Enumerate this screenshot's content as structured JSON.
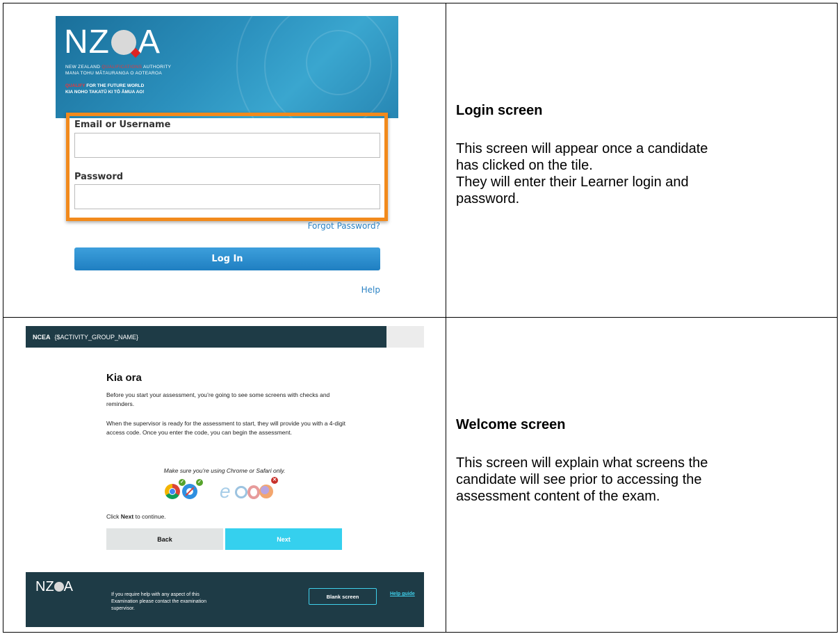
{
  "login_screenshot": {
    "logo_text_left": "NZ",
    "logo_text_right": "A",
    "org_line1_a": "NEW ZEALAND",
    "org_line1_red": "QUALIFICATIONS",
    "org_line1_b": "AUTHORITY",
    "org_line2": "MANA TOHU MĀTAURANGA O AOTEAROA",
    "tagline_red": "QUALIFY",
    "tagline_rest": "FOR THE FUTURE WORLD",
    "tagline2": "KIA NOHO TAKATŪ KI TŌ ĀMUA AO!",
    "email_label": "Email or Username",
    "email_value": "",
    "password_label": "Password",
    "password_value": "",
    "forgot_link": "Forgot Password?",
    "login_button": "Log In",
    "help_link": "Help",
    "highlight_color": "#f28a1c"
  },
  "login_description": {
    "title": "Login screen",
    "line1": "This screen will appear once a candidate",
    "line2": "has clicked on the tile.",
    "line3": "They will enter their Learner login and",
    "line4": "password."
  },
  "welcome_screenshot": {
    "bar_brand": "NCEA",
    "bar_activity": "{$ACTIVITY_GROUP_NAME}",
    "heading": "Kia ora",
    "para1": "Before you start your assessment, you’re going to see some screens with checks and reminders.",
    "para2": "When the supervisor is ready for the assessment to start, they will provide you with a 4-digit access code. Once you enter the code, you can begin the assessment.",
    "browser_note": "Make sure you’re using Chrome or Safari only.",
    "continue_prefix": "Click ",
    "continue_bold": "Next",
    "continue_suffix": " to continue.",
    "back_button": "Back",
    "next_button": "Next",
    "footer_logo_left": "NZ",
    "footer_logo_right": "A",
    "footer_help": "If you require help with any aspect of this Examination please contact the examination supervisor.",
    "blank_screen_button": "Blank screen",
    "help_guide_link": "Help guide",
    "browser_icons": [
      "chrome-icon",
      "safari-icon",
      "edge-icon",
      "ie-icon",
      "opera-icon",
      "firefox-icon"
    ]
  },
  "welcome_description": {
    "title": "Welcome screen",
    "line1": "This screen will explain what screens the",
    "line2": "candidate will see prior to accessing the",
    "line3": "assessment content of the exam."
  }
}
